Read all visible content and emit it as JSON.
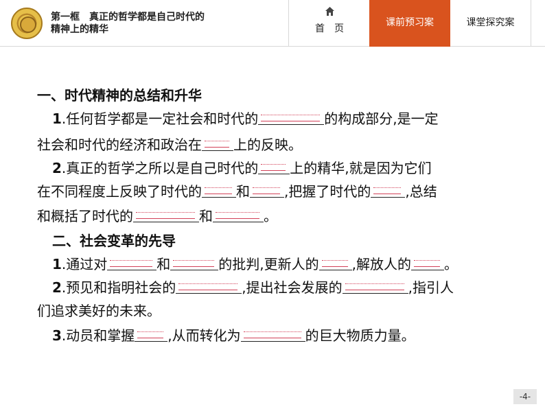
{
  "header": {
    "title_line1": "第一框　真正的哲学都是自己时代的",
    "title_line2": "精神上的精华",
    "nav_home": "首　页",
    "nav_preview": "课前预习案",
    "nav_class": "课堂探究案"
  },
  "body": {
    "h1": "一、时代精神的总结和升华",
    "p1_num": "1",
    "p1_a": ".任何哲学都是一定社会和时代的",
    "p1_b": "的构成部分,是一定",
    "p1_c": "社会和时代的经济和政治在",
    "p1_d": "上的反映。",
    "p2_num": "2",
    "p2_a": ".真正的哲学之所以是自己时代的",
    "p2_b": "上的精华,就是因为它们",
    "p2_c": "在不同程度上反映了时代的",
    "p2_d": "和",
    "p2_e": ",把握了时代的",
    "p2_f": ",总结",
    "p2_g": "和概括了时代的",
    "p2_h": "和",
    "p2_i": "。",
    "h2": "二、社会变革的先导",
    "p3_num": "1",
    "p3_a": ".通过对",
    "p3_b": "和",
    "p3_c": "的批判,更新人的",
    "p3_d": ",解放人的",
    "p3_e": "。",
    "p4_num": "2",
    "p4_a": ".预见和指明社会的",
    "p4_b": ",提出社会发展的",
    "p4_c": ",指引人",
    "p4_d": "们追求美好的未来。",
    "p5_num": "3",
    "p5_a": ".动员和掌握",
    "p5_b": ",从而转化为",
    "p5_c": "的巨大物质力量。"
  },
  "page_number": "-4-"
}
